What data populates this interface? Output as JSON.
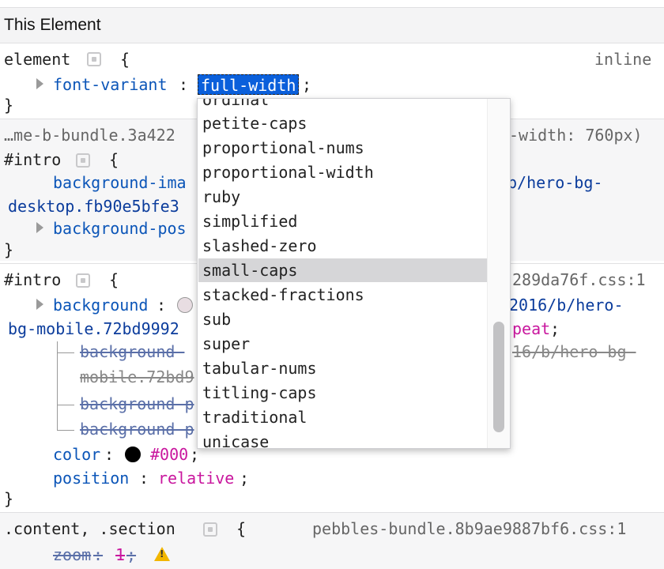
{
  "header": {
    "title": "This Element"
  },
  "element_rule": {
    "selector": "element",
    "brace_open": "{",
    "source": "inline",
    "property": "font-variant",
    "colon": ":",
    "editor_value": "full-width",
    "semicolon": ";",
    "brace_close": "}"
  },
  "rule_intro_1": {
    "source": "…me-b-bundle.3a422",
    "media": "-width: 760px)",
    "selector": "#intro",
    "brace_open": "{",
    "prop1": "background-ima",
    "prop1_val_right": "b/hero-bg-",
    "prop1_val_line2": "desktop.fb90e5bfe3",
    "prop2": "background-pos",
    "brace_close": "}"
  },
  "rule_intro_2": {
    "selector": "#intro",
    "brace_open": "{",
    "source": "289da76f.css:1",
    "prop_bg": "background",
    "colon": ":",
    "bg_val_right": "2016/b/hero-",
    "bg_val_line2": "bg-mobile.72bd9992",
    "bg_val_end": "peat",
    "semicolon": ";",
    "sub1": "background-",
    "sub1_val_right": "16/b/hero-bg-",
    "sub1_line2": "mobile.72bd9",
    "sub2": "background-p",
    "sub3": "background-p",
    "color_prop": "color",
    "color_val": "#000",
    "color_swatch": "#000000",
    "bg_swatch": "#e8dde2",
    "position_prop": "position",
    "position_val": "relative",
    "brace_close": "}"
  },
  "rule_content": {
    "selector": ".content, .section",
    "brace_open": "{",
    "source": "pebbles-bundle.8b9ae9887bf6.css:1",
    "zoom_prop": "zoom",
    "zoom_val": "1",
    "warning_icon": "warning-icon"
  },
  "autocomplete": {
    "items": [
      "ordinal",
      "petite-caps",
      "proportional-nums",
      "proportional-width",
      "ruby",
      "simplified",
      "slashed-zero",
      "small-caps",
      "stacked-fractions",
      "sub",
      "super",
      "tabular-nums",
      "titling-caps",
      "traditional",
      "unicase"
    ],
    "selected": "small-caps"
  },
  "colors": {
    "property": "#0b55b8",
    "value_magenta": "#c9179e",
    "editor_bg": "#0a5fdb",
    "warning": "#f2b600"
  }
}
